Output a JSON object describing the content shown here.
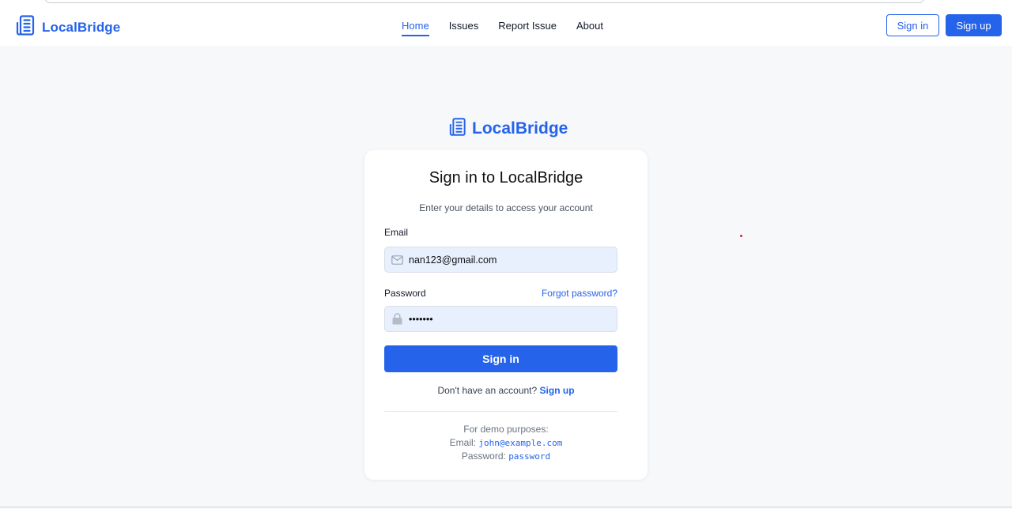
{
  "brand": {
    "name": "LocalBridge",
    "icon": "building-icon",
    "color": "#2563eb"
  },
  "nav": {
    "links": [
      {
        "label": "Home",
        "active": true
      },
      {
        "label": "Issues",
        "active": false
      },
      {
        "label": "Report Issue",
        "active": false
      },
      {
        "label": "About",
        "active": false
      }
    ],
    "signin_label": "Sign in",
    "signup_label": "Sign up"
  },
  "login": {
    "title": "Sign in to LocalBridge",
    "subtitle": "Enter your details to access your account",
    "email_label": "Email",
    "email_value": "nan123@gmail.com",
    "email_icon": "mail-icon",
    "password_label": "Password",
    "password_value": "•••••••",
    "password_icon": "lock-icon",
    "forgot_label": "Forgot password?",
    "submit_label": "Sign in",
    "no_account_text": "Don't have an account?",
    "signup_link": "Sign up",
    "demo_heading": "For demo purposes:",
    "demo_email_label": "Email:",
    "demo_email": "john@example.com",
    "demo_password_label": "Password:",
    "demo_password": "password"
  }
}
